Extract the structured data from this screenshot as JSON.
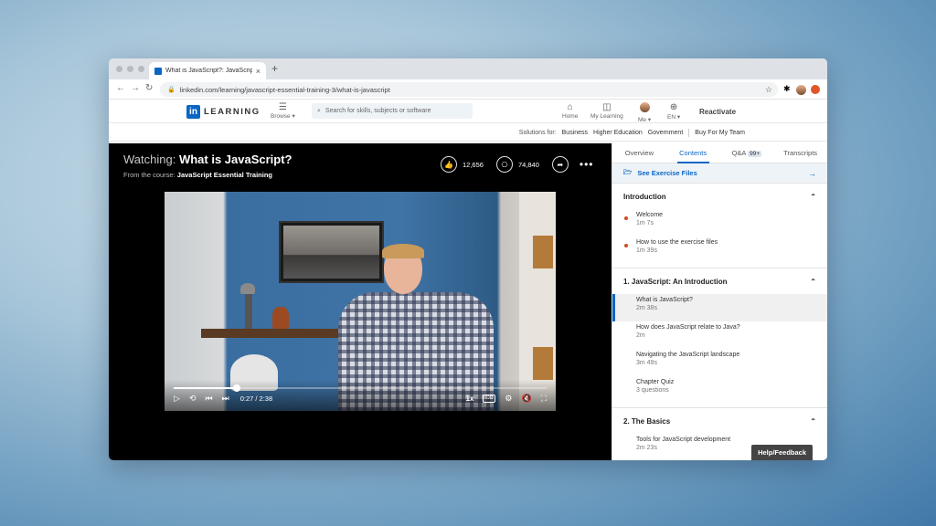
{
  "browser": {
    "tab_title": "What is JavaScript?: JavaScript",
    "tab_close": "×",
    "new_tab": "+",
    "url": "linkedin.com/learning/javascript-essential-training-3/what-is-javascript"
  },
  "header": {
    "logo_in": "in",
    "logo_text": "LEARNING",
    "browse_label": "Browse ▾",
    "search_placeholder": "Search for skills, subjects or software",
    "nav": [
      {
        "label": "Home",
        "icon": "home-icon"
      },
      {
        "label": "My Learning",
        "icon": "book-icon"
      },
      {
        "label": "Me ▾",
        "icon": "avatar"
      },
      {
        "label": "EN ▾",
        "icon": "globe-icon"
      }
    ],
    "reactivate": "Reactivate"
  },
  "solutions_bar": {
    "prefix": "Solutions for:",
    "items": [
      "Business",
      "Higher Education",
      "Government"
    ],
    "buy": "Buy For My Team"
  },
  "player": {
    "watching_prefix": "Watching:",
    "video_title": "What is JavaScript?",
    "from_prefix": "From the course:",
    "course_title": "JavaScript Essential Training",
    "likes": "12,656",
    "saves": "74,840",
    "time": "0:27 / 2:38",
    "progress_fraction": 0.17,
    "speed": "1x",
    "cc": "CC"
  },
  "sidebar": {
    "tabs": [
      {
        "label": "Overview"
      },
      {
        "label": "Contents"
      },
      {
        "label": "Q&A",
        "badge": "99+"
      },
      {
        "label": "Transcripts"
      }
    ],
    "exercise_files": "See Exercise Files",
    "sections": [
      {
        "title": "Introduction",
        "items": [
          {
            "title": "Welcome",
            "duration": "1m 7s"
          },
          {
            "title": "How to use the exercise files",
            "duration": "1m 39s"
          }
        ]
      },
      {
        "title": "1. JavaScript: An Introduction",
        "items": [
          {
            "title": "What is JavaScript?",
            "duration": "2m 38s"
          },
          {
            "title": "How does JavaScript relate to Java?",
            "duration": "2m"
          },
          {
            "title": "Navigating the JavaScript landscape",
            "duration": "3m 49s"
          },
          {
            "title": "Chapter Quiz",
            "duration": "3 questions"
          }
        ]
      },
      {
        "title": "2. The Basics",
        "items": [
          {
            "title": "Tools for JavaScript development",
            "duration": "2m 23s"
          }
        ]
      }
    ],
    "help_feedback": "Help/Feedback"
  },
  "colors": {
    "accent": "#0a66c2",
    "progress_dot": "#d14a1e"
  }
}
